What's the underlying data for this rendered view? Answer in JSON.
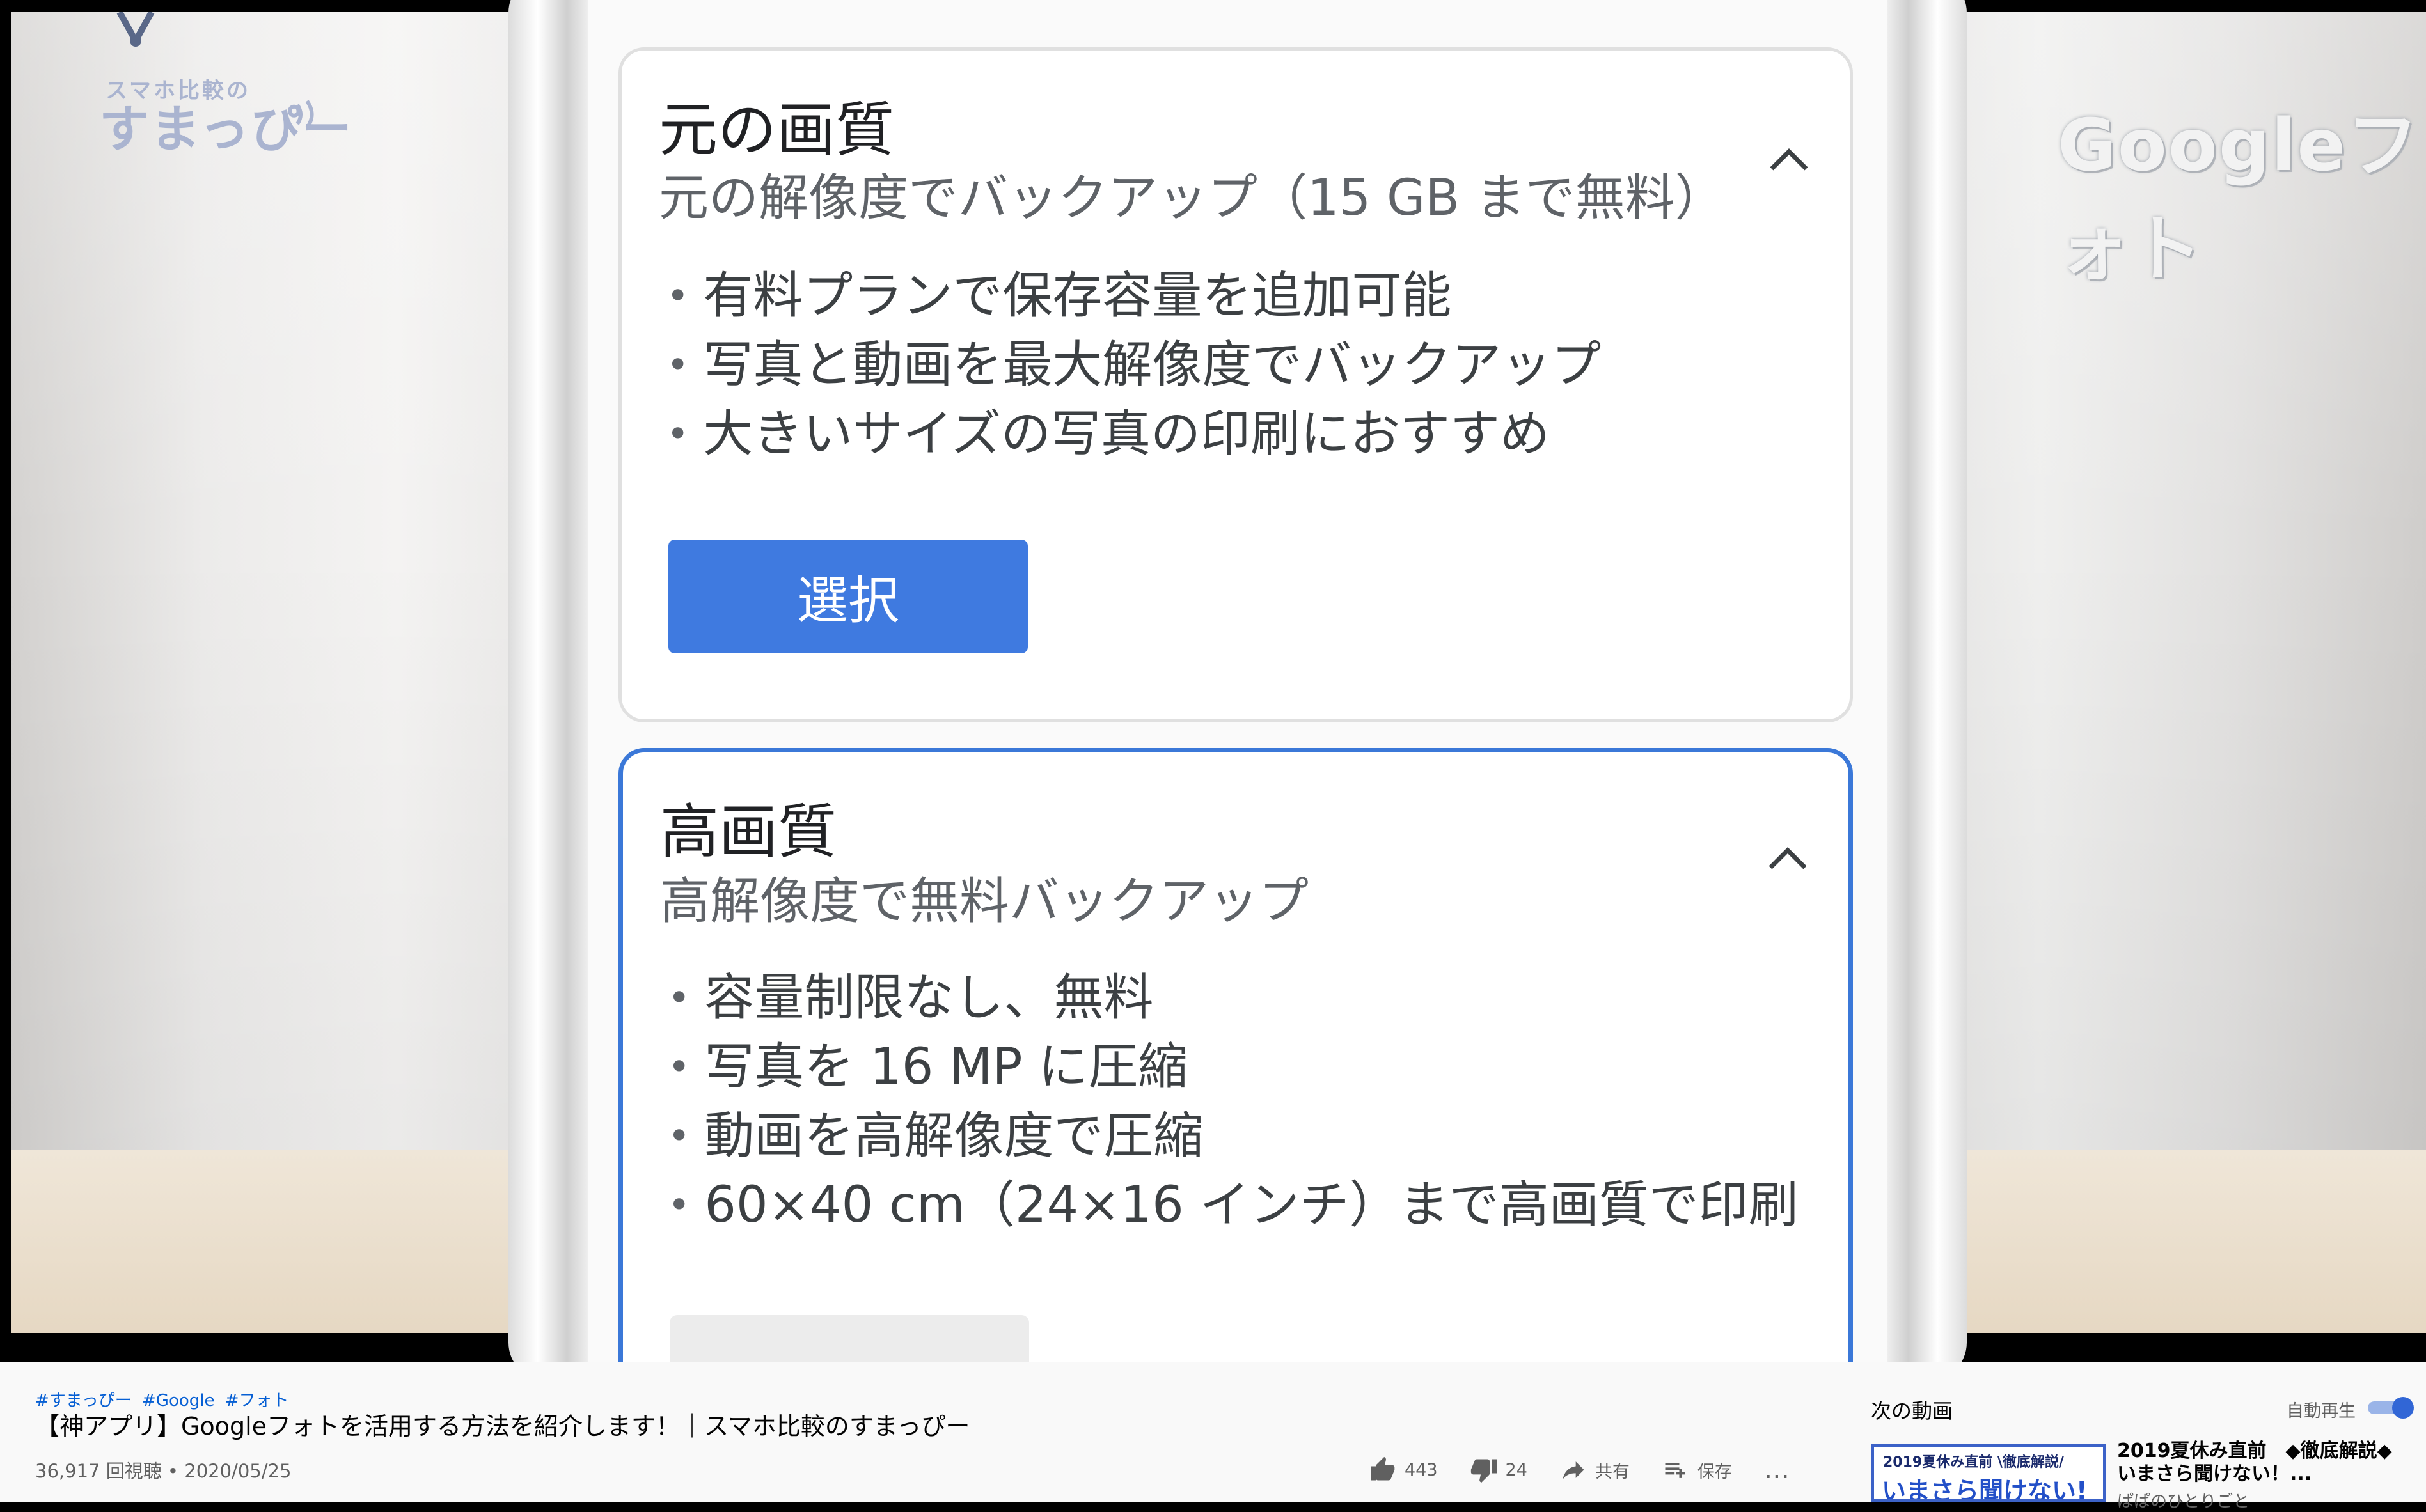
{
  "video": {
    "logo": {
      "top": "スマホ比較の",
      "main": "すまっぴー"
    },
    "brand": "Googleフォト",
    "card_original": {
      "title": "元の画質",
      "subtitle": "元の解像度でバックアップ（15 GB まで無料）",
      "bullets": [
        "有料プランで保存容量を追加可能",
        "写真と動画を最大解像度でバックアップ",
        "大きいサイズの写真の印刷におすすめ"
      ],
      "button": "選択",
      "chevron_icon": "chevron-up-icon"
    },
    "card_high": {
      "title": "高画質",
      "subtitle": "高解像度で無料バックアップ",
      "bullets": [
        "容量制限なし、無料",
        "写真を 16 MP に圧縮",
        "動画を高解像度で圧縮",
        "60×40 cm（24×16 インチ）まで高画質で印刷"
      ],
      "chevron_icon": "chevron-up-icon"
    }
  },
  "meta": {
    "hashtags": [
      "#すまっぴー",
      "#Google",
      "#フォト"
    ],
    "title": "【神アプリ】Googleフォトを活用する方法を紹介します！｜スマホ比較のすまっぴー",
    "views": "36,917 回視聴",
    "date": "2020/05/25",
    "separator": "•",
    "likes": "443",
    "dislikes": "24",
    "share": "共有",
    "save": "保存",
    "more": "…"
  },
  "sidebar": {
    "up_next": "次の動画",
    "autoplay": "自動再生",
    "autoplay_on": true,
    "thumb_line1": "2019夏休み直前 \\徹底解説/",
    "thumb_line2": "いまさら聞けない!",
    "next_title": "2019夏休み直前　◆徹底解説◆　いまさら聞けない！...",
    "next_channel": "ぱぱのひとりごと"
  },
  "colors": {
    "accent": "#3f7ae0",
    "selected_border": "#3b78d8",
    "link": "#065fd4"
  }
}
